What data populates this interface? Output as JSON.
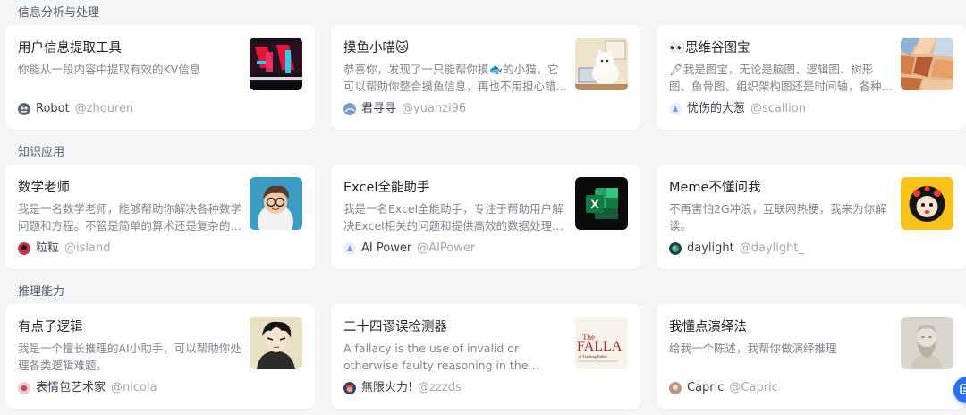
{
  "sections": [
    {
      "title": "信息分析与处理",
      "cards": [
        {
          "title": "用户信息提取工具",
          "desc": "你能从一段内容中提取有效的KV信息",
          "author": "Robot",
          "handle": "@zhouren"
        },
        {
          "title": "摸鱼小喵🐱",
          "desc": "恭喜你，发现了一只能帮你摸🐟的小猫，它可以帮助你整合摸鱼信息，再也不用担心错过任何精彩内容",
          "author": "君寻寻",
          "handle": "@yuanzi96"
        },
        {
          "title": "👀思维谷图宝",
          "desc": "🖊我是图宝，无论是脑图、逻辑图、树形图、鱼骨图、组织架构图还是时间轴，各种图形都可以帮你画出来",
          "author": "忧伤的大葱",
          "handle": "@scallion"
        }
      ]
    },
    {
      "title": "知识应用",
      "cards": [
        {
          "title": "数学老师",
          "desc": "我是一名数学老师，能够帮助你解决各种数学问题和方程。不管是简单的算术还是复杂的微积分",
          "author": "粒粒",
          "handle": "@island"
        },
        {
          "title": "Excel全能助手",
          "desc": "我是一名Excel全能助手，专注于帮助用户解决Excel相关的问题和提供高效的数据处理方案",
          "author": "AI Power",
          "handle": "@AIPower"
        },
        {
          "title": "Meme不懂问我",
          "desc": "不再害怕2G冲浪，互联网热梗，我来为你解读。",
          "author": "daylight",
          "handle": "@daylight_"
        }
      ]
    },
    {
      "title": "推理能力",
      "cards": [
        {
          "title": "有点子逻辑",
          "desc": "我是一个擅长推理的AI小助手，可以帮助你处理各类逻辑难题。",
          "author": "表情包艺术家",
          "handle": "@nicola"
        },
        {
          "title": "二十四谬误检测器",
          "desc": "A fallacy is the use of invalid or otherwise faulty reasoning in the construction of an argument",
          "author": "無限火力!",
          "handle": "@zzzds"
        },
        {
          "title": "我懂点演绎法",
          "desc": "给我一个陈述，我帮你做演绎推理",
          "author": "Capric",
          "handle": "@Capric"
        }
      ]
    }
  ],
  "thumb_texts": {
    "fallacy_big": "The",
    "fallacy_word": "FALLA",
    "fallacy_sub": "of Teaching Fables",
    "excel_letter": "X"
  },
  "icons": {
    "floating_button": "chat-icon"
  },
  "colors": {
    "page_bg": "#f4f5f7",
    "card_bg": "#ffffff",
    "accent": "#2b6ff6"
  }
}
